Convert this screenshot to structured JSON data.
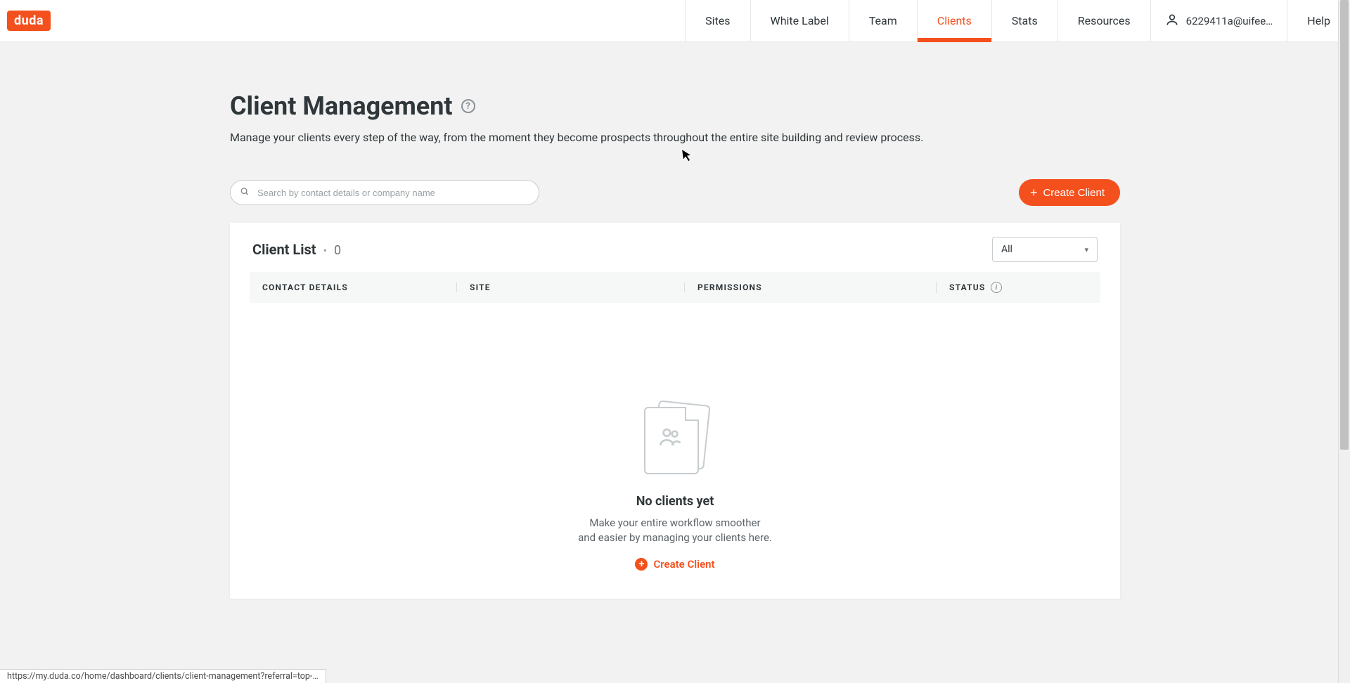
{
  "brand": {
    "name": "duda"
  },
  "nav": {
    "items": [
      {
        "label": "Sites",
        "active": false
      },
      {
        "label": "White Label",
        "active": false
      },
      {
        "label": "Team",
        "active": false
      },
      {
        "label": "Clients",
        "active": true
      },
      {
        "label": "Stats",
        "active": false
      },
      {
        "label": "Resources",
        "active": false
      }
    ],
    "user_email": "6229411a@uifee…",
    "help": "Help"
  },
  "page": {
    "title": "Client Management",
    "subtitle": "Manage your clients every step of the way, from the moment they become prospects throughout the entire site building and review process."
  },
  "search": {
    "placeholder": "Search by contact details or company name"
  },
  "actions": {
    "create_client": "Create Client"
  },
  "client_list": {
    "title": "Client List",
    "count": "0",
    "filter_selected": "All",
    "columns": {
      "contact": "CONTACT DETAILS",
      "site": "SITE",
      "permissions": "PERMISSIONS",
      "status": "STATUS"
    }
  },
  "empty": {
    "title": "No clients yet",
    "line1": "Make your entire workflow smoother",
    "line2": "and easier by managing your clients here.",
    "cta": "Create Client"
  },
  "statusbar": {
    "url": "https://my.duda.co/home/dashboard/clients/client-management?referral=top-…"
  }
}
